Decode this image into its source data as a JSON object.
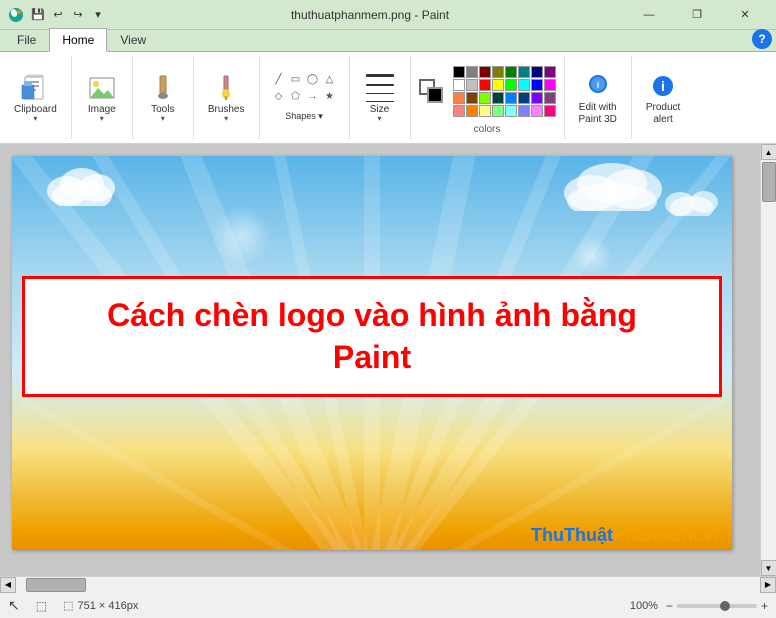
{
  "titlebar": {
    "title": "thuthuatphanmem.png - Paint",
    "min_label": "—",
    "max_label": "❐",
    "close_label": "✕"
  },
  "ribbon_tabs": [
    {
      "id": "file",
      "label": "File"
    },
    {
      "id": "home",
      "label": "Home",
      "active": true
    },
    {
      "id": "view",
      "label": "View"
    }
  ],
  "ribbon": {
    "groups": [
      {
        "id": "clipboard",
        "label": "Clipboard"
      },
      {
        "id": "image",
        "label": "Image"
      },
      {
        "id": "tools",
        "label": "Tools"
      },
      {
        "id": "brushes",
        "label": "Brushes"
      },
      {
        "id": "shapes",
        "label": "Shapes"
      },
      {
        "id": "size",
        "label": "Size"
      },
      {
        "id": "colors",
        "label": "Colors"
      },
      {
        "id": "edit_with_paint3d",
        "label": "Edit with\nPaint 3D"
      },
      {
        "id": "product_alert",
        "label": "Product\nalert"
      }
    ]
  },
  "canvas": {
    "banner_line1": "Cách chèn logo vào hình ảnh bằng",
    "banner_line2": "Paint"
  },
  "statusbar": {
    "dimensions": "751 × 416px",
    "zoom": "100%",
    "watermark": {
      "thu": "Thu",
      "thuat": "Thuật",
      "phan": "Phần",
      "mem": "Mềm",
      "vn": ".vn"
    }
  },
  "colors": {
    "label": "Colors",
    "swatches": [
      "#000000",
      "#808080",
      "#800000",
      "#808000",
      "#008000",
      "#008080",
      "#000080",
      "#800080",
      "#ffffff",
      "#c0c0c0",
      "#ff0000",
      "#ffff00",
      "#00ff00",
      "#00ffff",
      "#0000ff",
      "#ff00ff",
      "#ff8040",
      "#804000",
      "#80ff00",
      "#004040",
      "#0080ff",
      "#004080",
      "#8000ff",
      "#804080",
      "#ff8080",
      "#ff8000",
      "#ffff80",
      "#80ff80",
      "#80ffff",
      "#8080ff",
      "#ff80ff",
      "#ff0080"
    ]
  }
}
